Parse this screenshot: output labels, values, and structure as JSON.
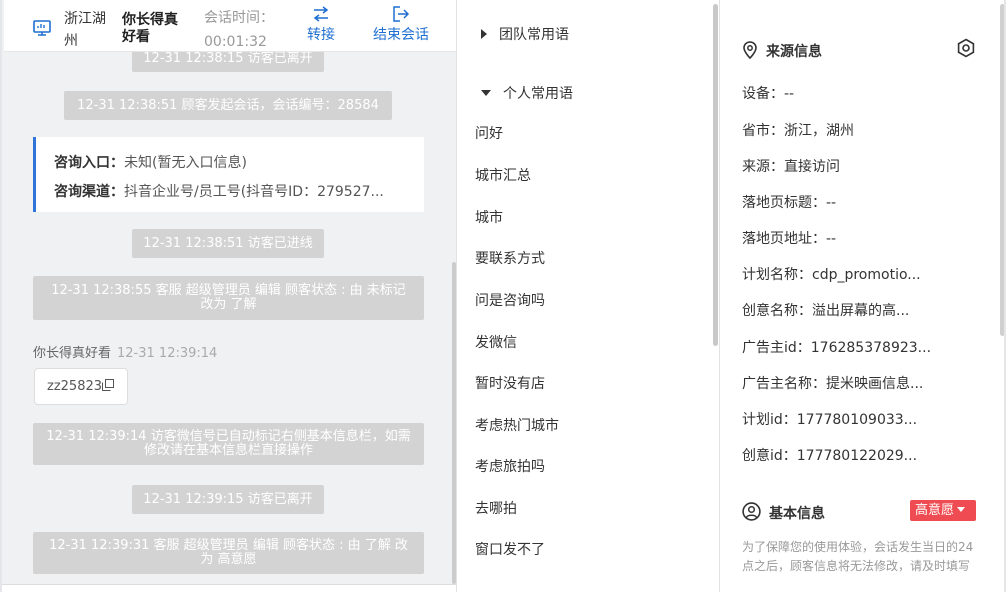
{
  "header": {
    "region": "浙江湖州",
    "visitor_name": "你长得真好看",
    "session_label": "会话时间：",
    "session_time": "00:01:32",
    "transfer_label": "转接",
    "end_label": "结束会话"
  },
  "chat": {
    "top_partial": "12-31 12:38:15 访客已离开",
    "sys1": "12-31 12:38:51 顾客发起会话，会话编号：28584",
    "consult_entry_label": "咨询入口：",
    "consult_entry_value": "未知(暂无入口信息)",
    "consult_channel_label": "咨询渠道：",
    "consult_channel_value": "抖音企业号/员工号(抖音号ID：279527...",
    "sys2": "12-31 12:38:51 访客已进线",
    "sys3": "12-31 12:38:55 客服 超级管理员 编辑 顾客状态 : 由 未标记 改为 了解",
    "msg_sender": "你长得真好看",
    "msg_time": "12-31 12:39:14",
    "msg_text": "zz25823",
    "sys4": "12-31 12:39:14 访客微信号已自动标记右侧基本信息栏，如需修改请在基本信息栏直接操作",
    "sys5": "12-31 12:39:15 访客已离开",
    "sys6": "12-31 12:39:31 客服 超级管理员 编辑 顾客状态 : 由 了解 改为 高意愿"
  },
  "phrases": {
    "team_label": "团队常用语",
    "personal_label": "个人常用语",
    "items": [
      "问好",
      "城市汇总",
      "城市",
      "要联系方式",
      "问是咨询吗",
      "发微信",
      "暂时没有店",
      "考虑热门城市",
      "考虑旅拍吗",
      "去哪拍",
      "窗口发不了"
    ]
  },
  "source": {
    "title": "来源信息",
    "fields": [
      "设备：--",
      "省市：浙江，湖州",
      "来源：直接访问",
      "落地页标题：--",
      "落地页地址：--",
      "计划名称：cdp_promotio...",
      "创意名称：溢出屏幕的高...",
      "广告主id：176285378923...",
      "广告主名称：提米映画信息...",
      "计划id：177780109033...",
      "创意id：177780122029..."
    ]
  },
  "basic": {
    "title": "基本信息",
    "intent": "高意愿",
    "note": "为了保障您的使用体验，会话发生当日的24点之后，顾客信息将无法修改，请及时填写"
  },
  "colors": {
    "accent": "#1f6fd1",
    "badge": "#ee4c52",
    "system_msg": "#d3d3d3"
  }
}
